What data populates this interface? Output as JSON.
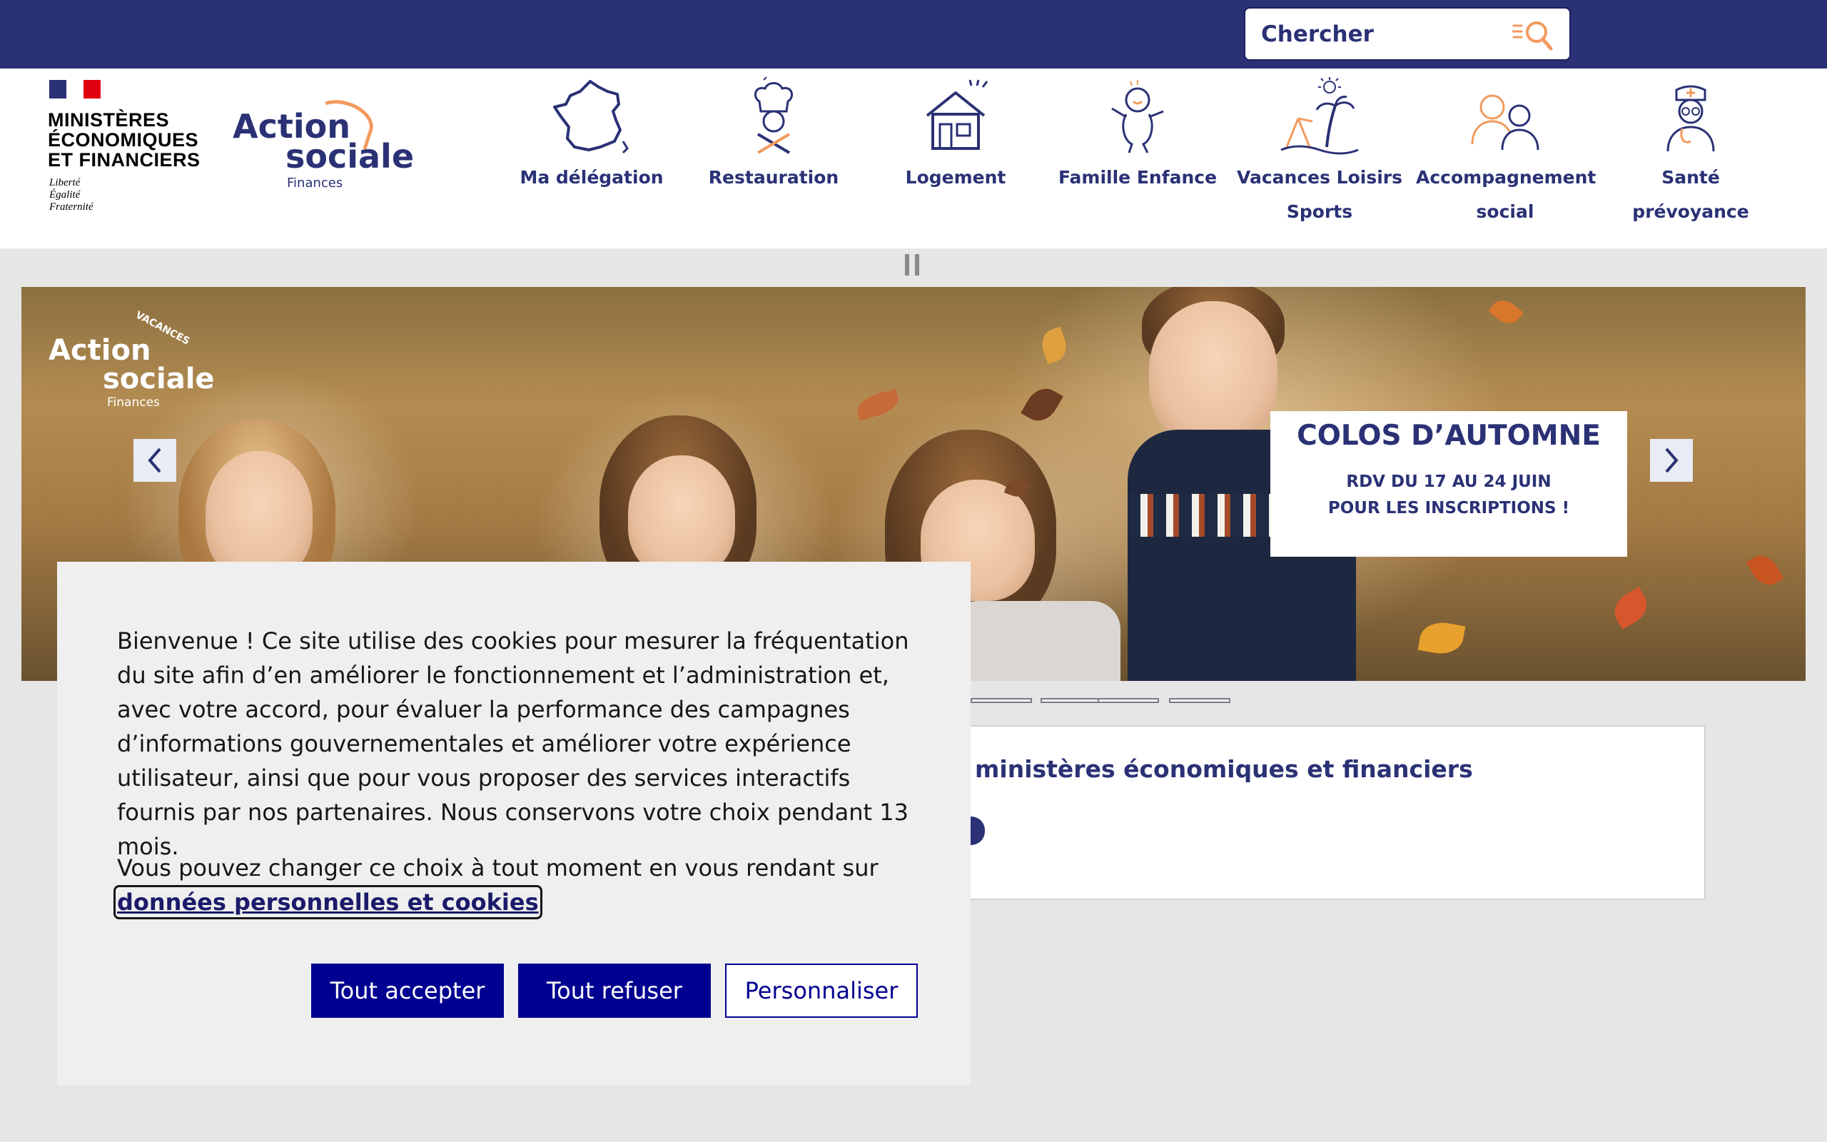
{
  "search": {
    "placeholder": "Chercher"
  },
  "colors": {
    "topbar": "#2a3175",
    "brand_blue": "#2a3175",
    "accent_orange": "#f29a5d",
    "button_blue": "#000091"
  },
  "header": {
    "mef_logo": {
      "lines": [
        "MINISTÈRES",
        "ÉCONOMIQUES",
        "ET FINANCIERS"
      ],
      "motto": [
        "Liberté",
        "Égalité",
        "Fraternité"
      ]
    },
    "action_sociale_logo": {
      "line1": "Action",
      "line2": "sociale",
      "line3": "Finances"
    }
  },
  "nav": {
    "items": [
      {
        "label1": "Ma délégation",
        "label2": "",
        "icon": "france-map-icon"
      },
      {
        "label1": "Restauration",
        "label2": "",
        "icon": "chef-icon"
      },
      {
        "label1": "Logement",
        "label2": "",
        "icon": "house-icon"
      },
      {
        "label1": "Famille Enfance",
        "label2": "",
        "icon": "child-icon"
      },
      {
        "label1": "Vacances Loisirs",
        "label2": "Sports",
        "icon": "beach-palm-icon"
      },
      {
        "label1": "Accompagnement",
        "label2": "social",
        "icon": "people-icon"
      },
      {
        "label1": "Santé",
        "label2": "prévoyance",
        "icon": "nurse-icon"
      }
    ]
  },
  "hero": {
    "logo": {
      "small": "VACANCES",
      "line1": "Action",
      "line2": "sociale",
      "line3": "Finances"
    },
    "caption_title": "COLOS D’AUTOMNE",
    "caption_line1": "RDV DU 17 AU 24 JUIN",
    "caption_line2": "POUR LES INSCRIPTIONS !"
  },
  "card": {
    "title": "ministères économiques et financiers"
  },
  "cookie": {
    "text1": "Bienvenue ! Ce site utilise des cookies pour mesurer la fréquentation du site afin d’en améliorer le fonctionnement et l’administration et, avec votre accord, pour évaluer la performance des campagnes d’informations gouvernementales et améliorer votre expérience utilisateur, ainsi que pour vous proposer des services interactifs fournis par nos partenaires. Nous conservons votre choix pendant 13 mois.",
    "text2": "Vous pouvez changer ce choix à tout moment en vous rendant sur",
    "link": "données personnelles et cookies",
    "accept": "Tout accepter",
    "refuse": "Tout refuser",
    "customize": "Personnaliser"
  }
}
